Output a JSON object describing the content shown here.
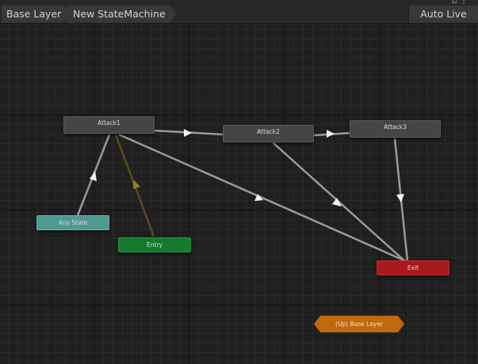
{
  "breadcrumb": {
    "items": [
      "Base Layer",
      "New StateMachine"
    ]
  },
  "toolbar": {
    "auto_live_link": "Auto Live Link"
  },
  "window_icons": "▫ ⋮",
  "graph": {
    "states": {
      "attack1": "Attack1",
      "attack2": "Attack2",
      "attack3": "Attack3",
      "any_state": "Any State",
      "entry": "Entry",
      "exit": "Exit",
      "up_base_layer": "(Up) Base Layer"
    }
  },
  "colors": {
    "canvas": "#202020",
    "state": "#454545",
    "any_state": "#4e9a93",
    "entry": "#167a2e",
    "exit": "#a91a1e",
    "up_layer": "#c06810",
    "transition": "#9a9a9a",
    "default_transition": "#5e4a1c"
  }
}
